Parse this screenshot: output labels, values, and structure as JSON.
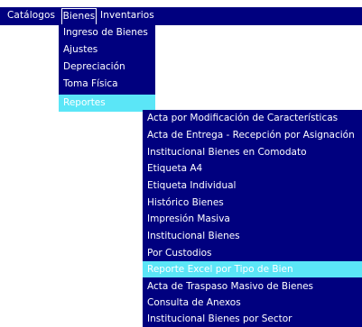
{
  "menubar": {
    "items": [
      "Catálogos",
      "Bienes",
      "Inventarios"
    ]
  },
  "bienes_menu": {
    "items": [
      "Ingreso de Bienes",
      "Ajustes",
      "Depreciación",
      "Toma Física",
      "Reportes"
    ],
    "active": "Reportes"
  },
  "reportes_menu": {
    "items": [
      "Acta por Modificación de Características",
      "Acta de Entrega - Recepción por Asignación",
      "Institucional Bienes en Comodato",
      "Etiqueta A4",
      "Etiqueta Individual",
      "Histórico Bienes",
      "Impresión Masiva",
      "Institucional Bienes",
      "Por Custodios",
      "Reporte Excel por Tipo de Bien",
      "Acta de Traspaso Masivo de Bienes",
      "Consulta de Anexos",
      "Institucional Bienes por Sector"
    ],
    "active": "Reporte Excel por Tipo de Bien"
  },
  "colors": {
    "menu_bg": "#00007f",
    "highlight": "#5be6f7",
    "text": "#ffffff"
  }
}
